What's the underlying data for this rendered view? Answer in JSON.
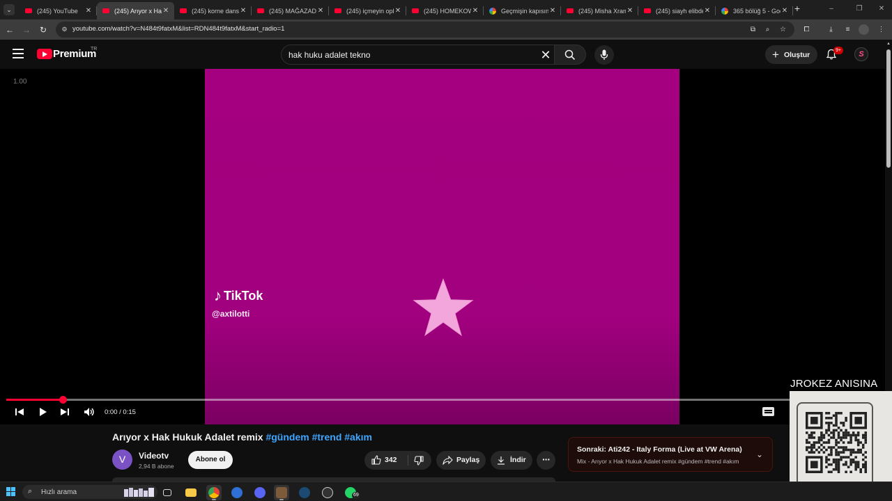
{
  "browser": {
    "tabs": [
      {
        "title": "(245) YouTube",
        "favicon": "youtube-icon",
        "active": false
      },
      {
        "title": "(245) Arıyor x Hak Hukuk",
        "favicon": "youtube-icon",
        "active": true
      },
      {
        "title": "(245) korne dans",
        "favicon": "youtube-icon",
        "active": false
      },
      {
        "title": "(245) MAĞAZADA",
        "favicon": "youtube-icon",
        "active": false
      },
      {
        "title": "(245) içmeyin ople",
        "favicon": "youtube-icon",
        "active": false
      },
      {
        "title": "(245) HOMEKOW",
        "favicon": "youtube-icon",
        "active": false
      },
      {
        "title": "Geçmişin kapısını",
        "favicon": "google-icon",
        "active": false
      },
      {
        "title": "(245) Misha Xramo",
        "favicon": "youtube-icon",
        "active": false
      },
      {
        "title": "(245) siayh elibde",
        "favicon": "youtube-icon",
        "active": false
      },
      {
        "title": "365 bölüğ 5 - Goo",
        "favicon": "google-icon",
        "active": false
      }
    ],
    "tab_close_glyph": "✕",
    "new_tab_glyph": "+",
    "url": "youtube.com/watch?v=N484t9fatxM&list=RDN484t9fatxM&start_radio=1"
  },
  "masthead": {
    "brand": "Premium",
    "region": "TR",
    "search_query": "hak huku adalet tekno",
    "create_label": "Oluştur",
    "notification_count": "9+",
    "account_initial": "S"
  },
  "player": {
    "speed_readout": "1.00",
    "tiktok_brand": "TikTok",
    "tiktok_handle": "@axtilotti",
    "current_time": "0:00",
    "duration": "0:15",
    "progress_fraction": 0.065,
    "video_bg_color": "#a4007f",
    "progress_color": "#ff0033"
  },
  "overlay": {
    "caption": "JROKEZ ANISINA"
  },
  "video": {
    "title_main": "Arıyor x Hak Hukuk Adalet remix",
    "hashtags": [
      "#gündem",
      "#trend",
      "#akım"
    ],
    "channel_initial": "V",
    "channel_name": "Videotv",
    "subscribers": "2,94 B abone",
    "subscribe_label": "Abone ol",
    "like_count": "342",
    "share_label": "Paylaş",
    "download_label": "İndir",
    "more_glyph": "···",
    "link_color": "#3ea6ff"
  },
  "next_up": {
    "title": "Sonraki: Ati242 - Italy Forma (Live at VW Arena)",
    "subtitle": "Mix - Arıyor x Hak Hukuk Adalet remix #gündem #trend #akım"
  },
  "taskbar": {
    "search_label": "Hızlı arama",
    "whatsapp_badge": "69"
  }
}
